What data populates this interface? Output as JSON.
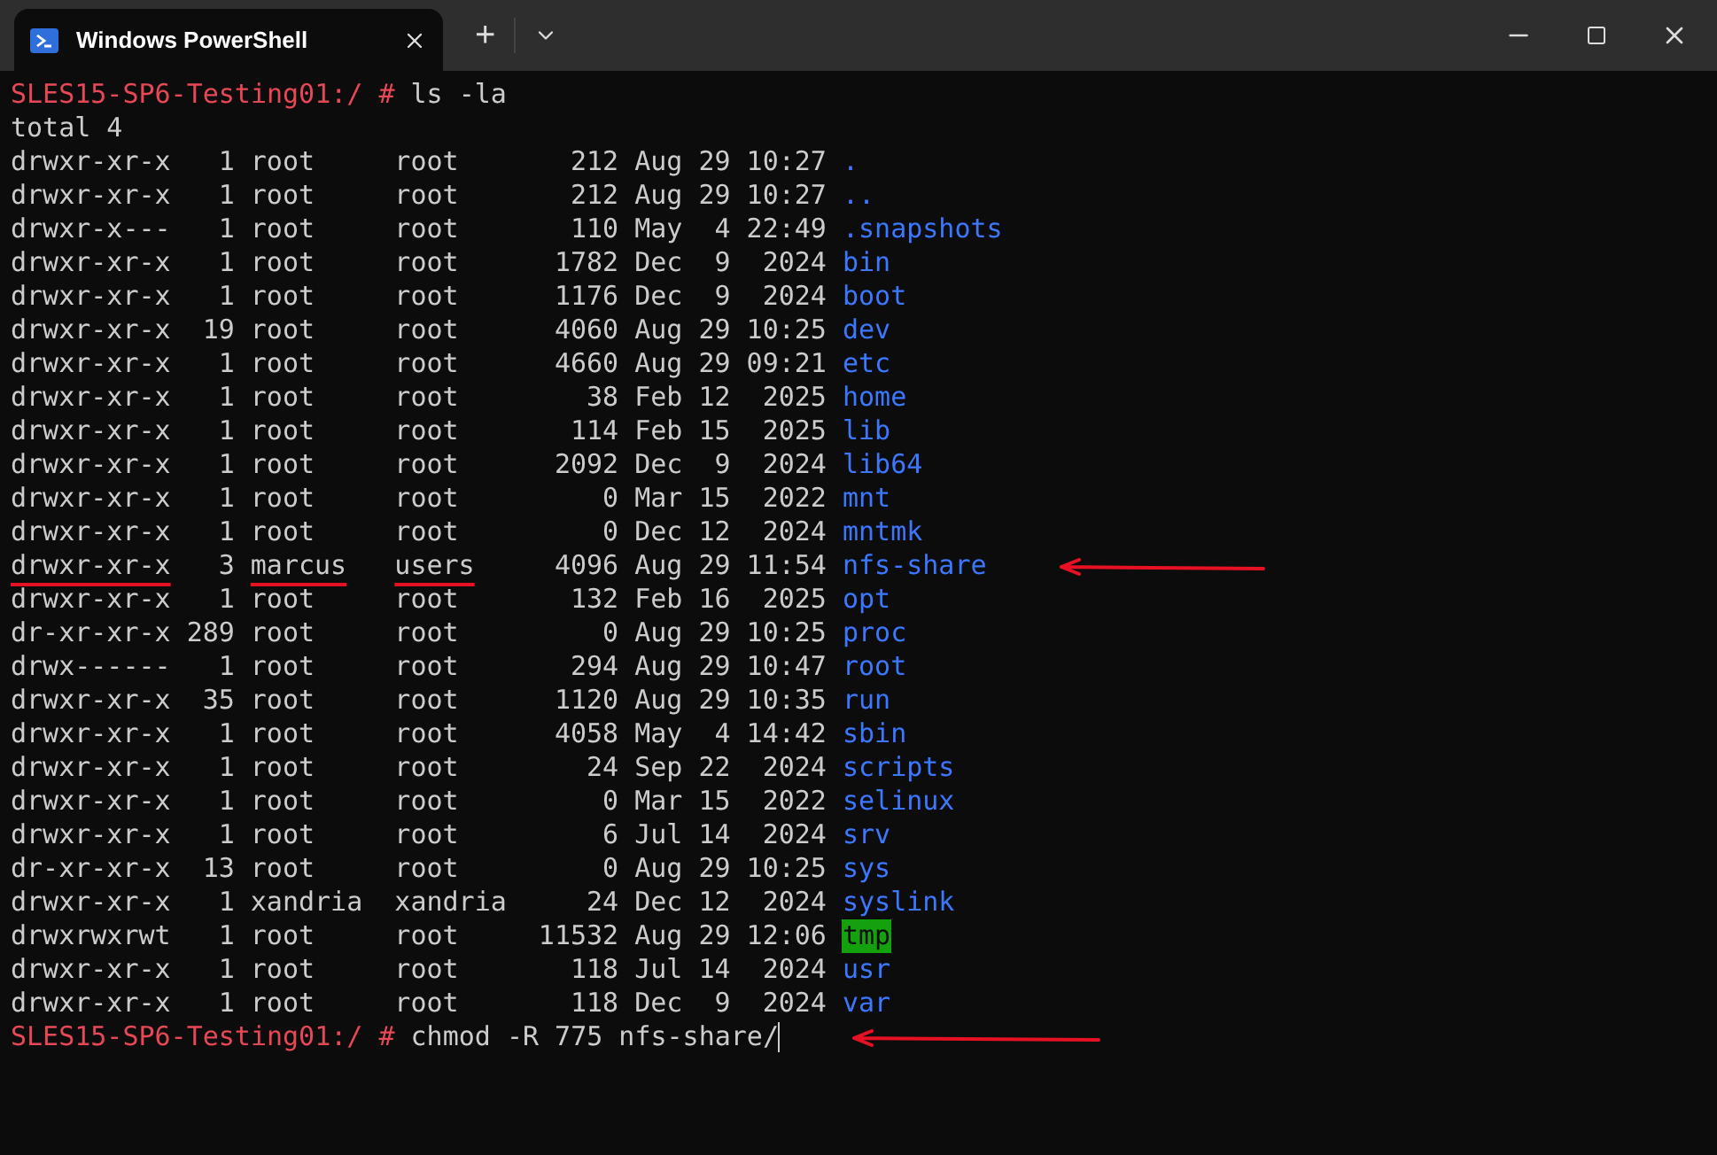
{
  "window": {
    "tab_title": "Windows PowerShell",
    "new_tab_button": "+"
  },
  "terminal": {
    "commands": [
      {
        "prompt": "SLES15-SP6-Testing01:/ #",
        "command": "ls -la",
        "arrow": false,
        "cursor": false
      },
      {
        "prompt": "SLES15-SP6-Testing01:/ #",
        "command": "chmod -R 775 nfs-share/",
        "arrow": true,
        "cursor": true
      }
    ],
    "total": "total 4",
    "listing": [
      {
        "perms": "drwxr-xr-x",
        "links": "1",
        "owner": "root",
        "group": "root",
        "size": "212",
        "date": "Aug 29 10:27",
        "name": ".",
        "kind": "dir",
        "underlined": false,
        "arrow": false
      },
      {
        "perms": "drwxr-xr-x",
        "links": "1",
        "owner": "root",
        "group": "root",
        "size": "212",
        "date": "Aug 29 10:27",
        "name": "..",
        "kind": "dir",
        "underlined": false,
        "arrow": false
      },
      {
        "perms": "drwxr-x---",
        "links": "1",
        "owner": "root",
        "group": "root",
        "size": "110",
        "date": "May  4 22:49",
        "name": ".snapshots",
        "kind": "dir",
        "underlined": false,
        "arrow": false
      },
      {
        "perms": "drwxr-xr-x",
        "links": "1",
        "owner": "root",
        "group": "root",
        "size": "1782",
        "date": "Dec  9  2024",
        "name": "bin",
        "kind": "dir",
        "underlined": false,
        "arrow": false
      },
      {
        "perms": "drwxr-xr-x",
        "links": "1",
        "owner": "root",
        "group": "root",
        "size": "1176",
        "date": "Dec  9  2024",
        "name": "boot",
        "kind": "dir",
        "underlined": false,
        "arrow": false
      },
      {
        "perms": "drwxr-xr-x",
        "links": "19",
        "owner": "root",
        "group": "root",
        "size": "4060",
        "date": "Aug 29 10:25",
        "name": "dev",
        "kind": "dir",
        "underlined": false,
        "arrow": false
      },
      {
        "perms": "drwxr-xr-x",
        "links": "1",
        "owner": "root",
        "group": "root",
        "size": "4660",
        "date": "Aug 29 09:21",
        "name": "etc",
        "kind": "dir",
        "underlined": false,
        "arrow": false
      },
      {
        "perms": "drwxr-xr-x",
        "links": "1",
        "owner": "root",
        "group": "root",
        "size": "38",
        "date": "Feb 12  2025",
        "name": "home",
        "kind": "dir",
        "underlined": false,
        "arrow": false
      },
      {
        "perms": "drwxr-xr-x",
        "links": "1",
        "owner": "root",
        "group": "root",
        "size": "114",
        "date": "Feb 15  2025",
        "name": "lib",
        "kind": "dir",
        "underlined": false,
        "arrow": false
      },
      {
        "perms": "drwxr-xr-x",
        "links": "1",
        "owner": "root",
        "group": "root",
        "size": "2092",
        "date": "Dec  9  2024",
        "name": "lib64",
        "kind": "dir",
        "underlined": false,
        "arrow": false
      },
      {
        "perms": "drwxr-xr-x",
        "links": "1",
        "owner": "root",
        "group": "root",
        "size": "0",
        "date": "Mar 15  2022",
        "name": "mnt",
        "kind": "dir",
        "underlined": false,
        "arrow": false
      },
      {
        "perms": "drwxr-xr-x",
        "links": "1",
        "owner": "root",
        "group": "root",
        "size": "0",
        "date": "Dec 12  2024",
        "name": "mntmk",
        "kind": "dir",
        "underlined": false,
        "arrow": false
      },
      {
        "perms": "drwxr-xr-x",
        "links": "3",
        "owner": "marcus",
        "group": "users",
        "size": "4096",
        "date": "Aug 29 11:54",
        "name": "nfs-share",
        "kind": "dir",
        "underlined": true,
        "arrow": true
      },
      {
        "perms": "drwxr-xr-x",
        "links": "1",
        "owner": "root",
        "group": "root",
        "size": "132",
        "date": "Feb 16  2025",
        "name": "opt",
        "kind": "dir",
        "underlined": false,
        "arrow": false
      },
      {
        "perms": "dr-xr-xr-x",
        "links": "289",
        "owner": "root",
        "group": "root",
        "size": "0",
        "date": "Aug 29 10:25",
        "name": "proc",
        "kind": "dir",
        "underlined": false,
        "arrow": false
      },
      {
        "perms": "drwx------",
        "links": "1",
        "owner": "root",
        "group": "root",
        "size": "294",
        "date": "Aug 29 10:47",
        "name": "root",
        "kind": "dir",
        "underlined": false,
        "arrow": false
      },
      {
        "perms": "drwxr-xr-x",
        "links": "35",
        "owner": "root",
        "group": "root",
        "size": "1120",
        "date": "Aug 29 10:35",
        "name": "run",
        "kind": "dir",
        "underlined": false,
        "arrow": false
      },
      {
        "perms": "drwxr-xr-x",
        "links": "1",
        "owner": "root",
        "group": "root",
        "size": "4058",
        "date": "May  4 14:42",
        "name": "sbin",
        "kind": "dir",
        "underlined": false,
        "arrow": false
      },
      {
        "perms": "drwxr-xr-x",
        "links": "1",
        "owner": "root",
        "group": "root",
        "size": "24",
        "date": "Sep 22  2024",
        "name": "scripts",
        "kind": "dir",
        "underlined": false,
        "arrow": false
      },
      {
        "perms": "drwxr-xr-x",
        "links": "1",
        "owner": "root",
        "group": "root",
        "size": "0",
        "date": "Mar 15  2022",
        "name": "selinux",
        "kind": "dir",
        "underlined": false,
        "arrow": false
      },
      {
        "perms": "drwxr-xr-x",
        "links": "1",
        "owner": "root",
        "group": "root",
        "size": "6",
        "date": "Jul 14  2024",
        "name": "srv",
        "kind": "dir",
        "underlined": false,
        "arrow": false
      },
      {
        "perms": "dr-xr-xr-x",
        "links": "13",
        "owner": "root",
        "group": "root",
        "size": "0",
        "date": "Aug 29 10:25",
        "name": "sys",
        "kind": "dir",
        "underlined": false,
        "arrow": false
      },
      {
        "perms": "drwxr-xr-x",
        "links": "1",
        "owner": "xandria",
        "group": "xandria",
        "size": "24",
        "date": "Dec 12  2024",
        "name": "syslink",
        "kind": "dir",
        "underlined": false,
        "arrow": false
      },
      {
        "perms": "drwxrwxrwt",
        "links": "1",
        "owner": "root",
        "group": "root",
        "size": "11532",
        "date": "Aug 29 12:06",
        "name": "tmp",
        "kind": "sticky",
        "underlined": false,
        "arrow": false
      },
      {
        "perms": "drwxr-xr-x",
        "links": "1",
        "owner": "root",
        "group": "root",
        "size": "118",
        "date": "Jul 14  2024",
        "name": "usr",
        "kind": "dir",
        "underlined": false,
        "arrow": false
      },
      {
        "perms": "drwxr-xr-x",
        "links": "1",
        "owner": "root",
        "group": "root",
        "size": "118",
        "date": "Dec  9  2024",
        "name": "var",
        "kind": "dir",
        "underlined": false,
        "arrow": false
      }
    ]
  }
}
